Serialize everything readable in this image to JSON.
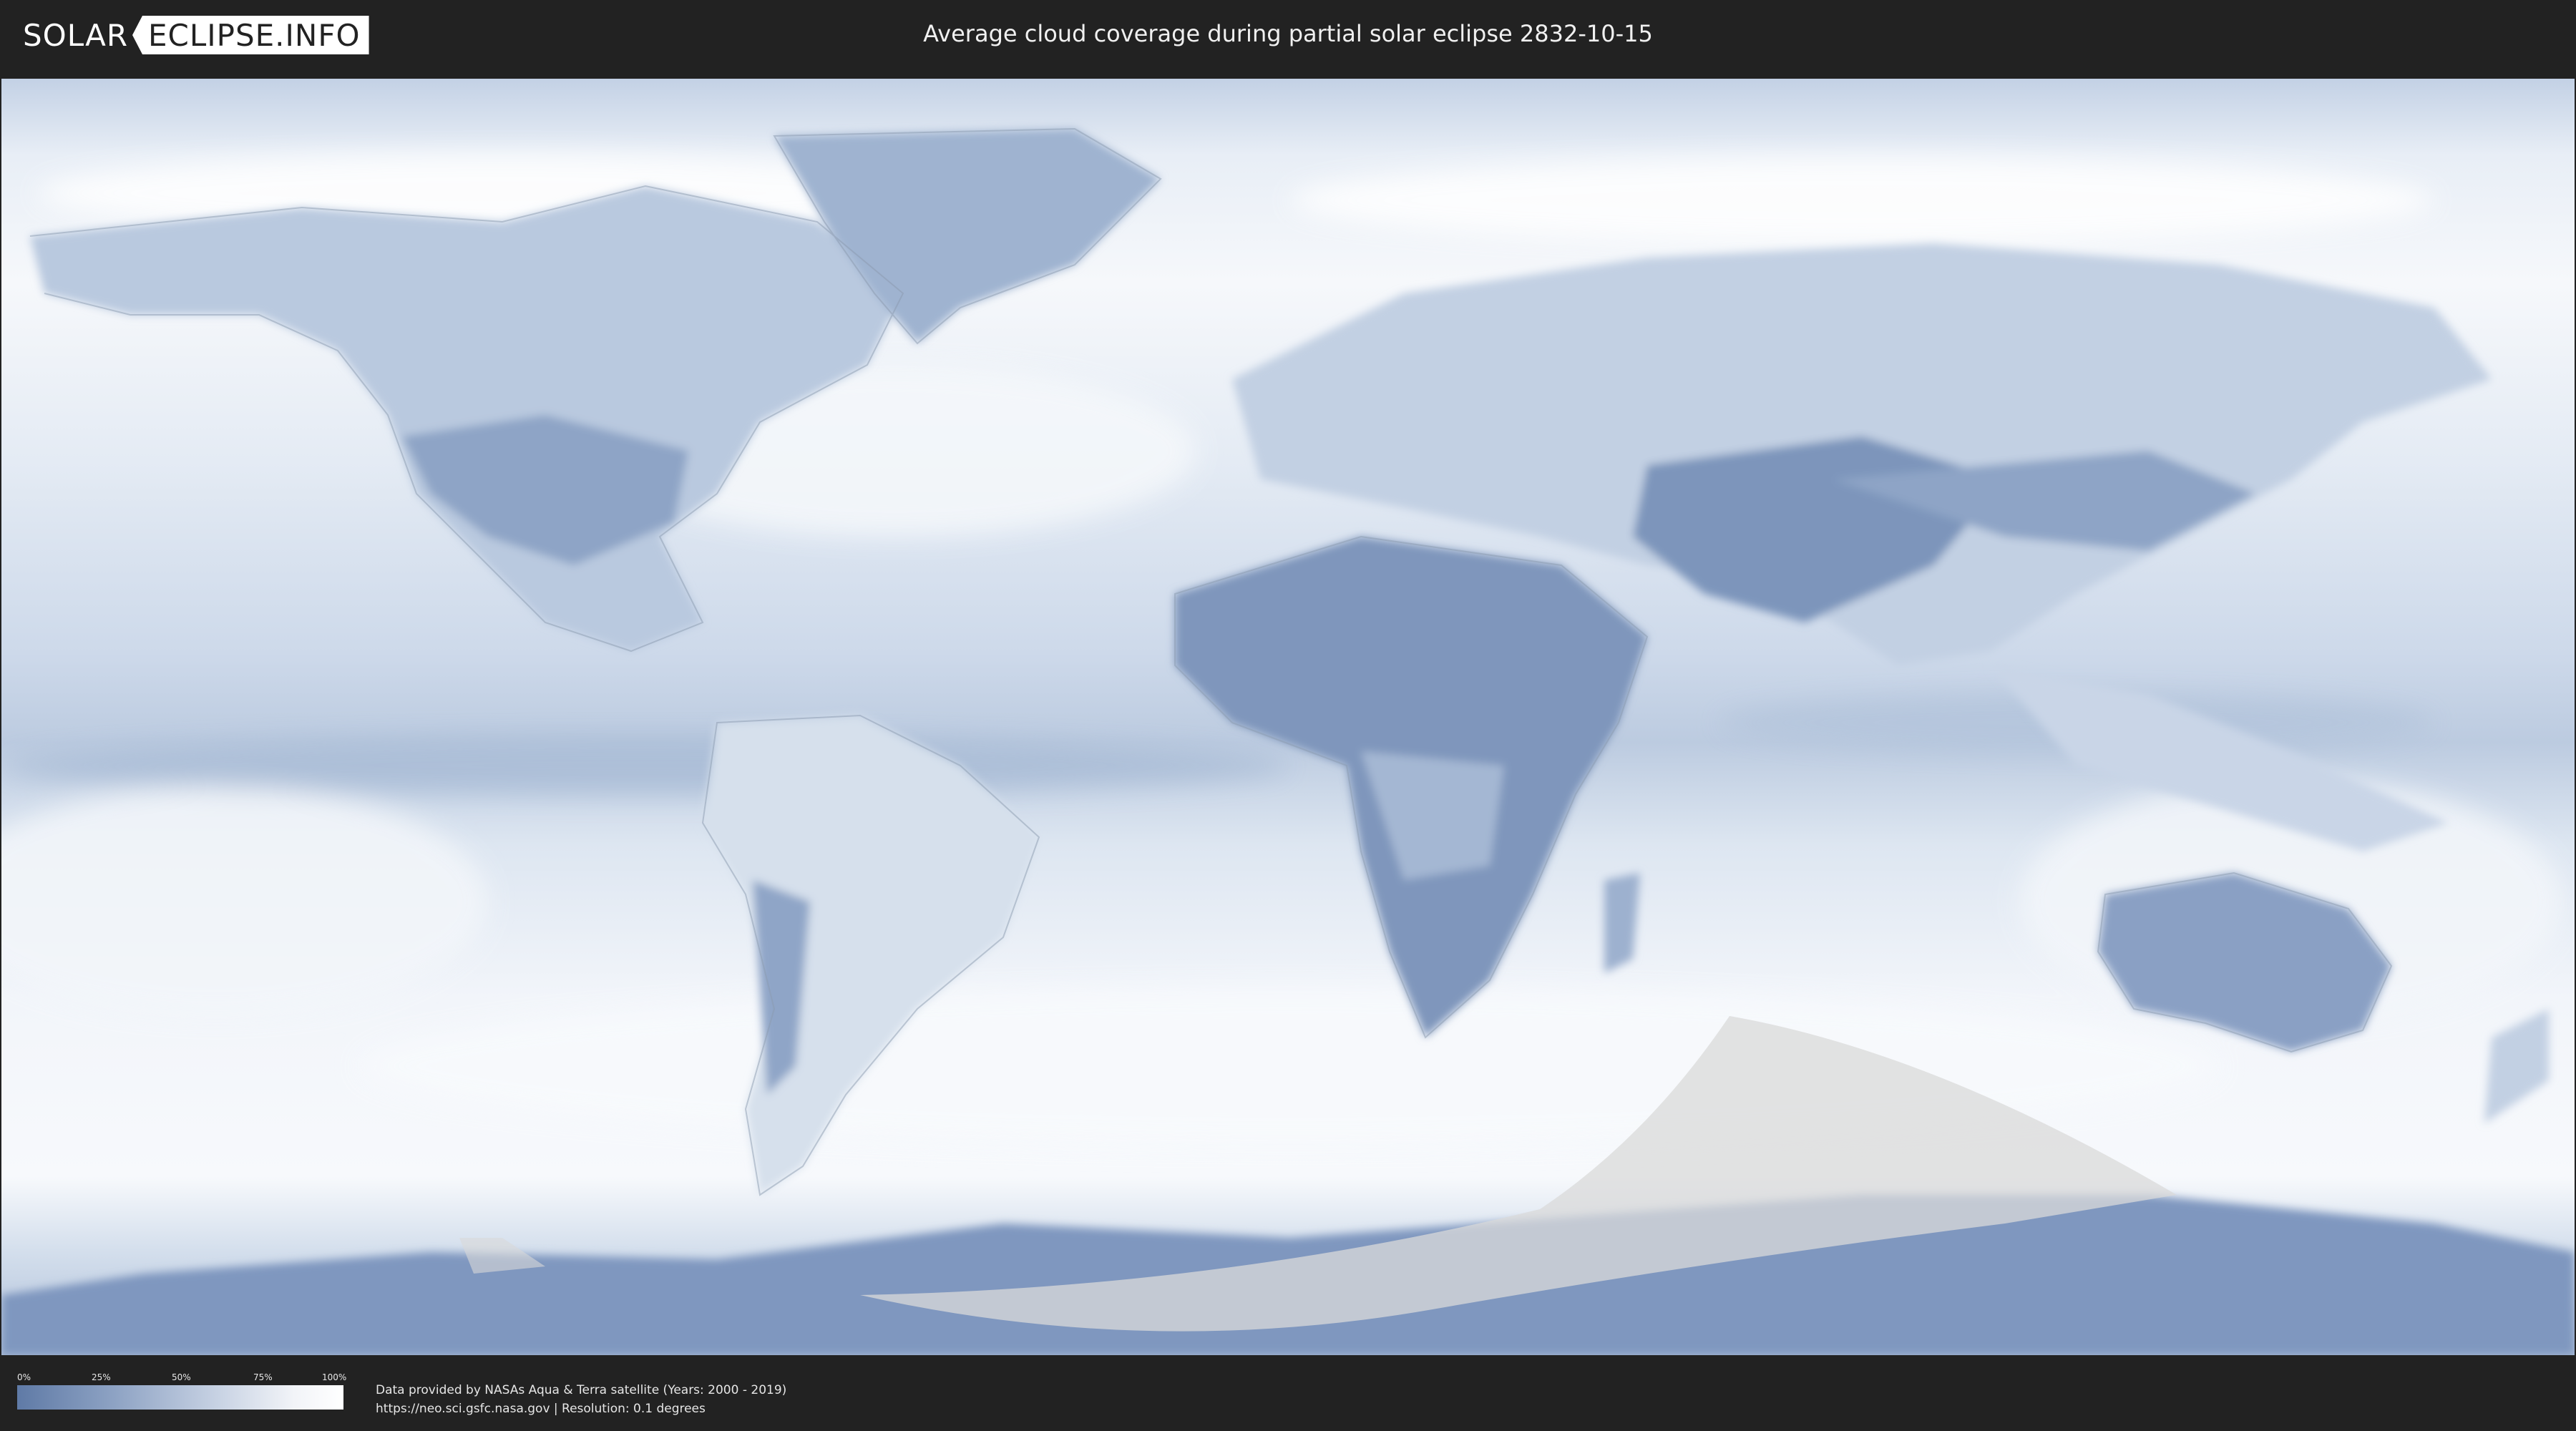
{
  "header": {
    "logo_left": "SOLAR",
    "logo_right": "ECLIPSE.INFO",
    "title": "Average cloud coverage during partial solar eclipse 2832-10-15"
  },
  "legend": {
    "ticks": [
      "0%",
      "25%",
      "50%",
      "75%",
      "100%"
    ],
    "colors": {
      "low": "#5f7aa6",
      "high": "#ffffff"
    }
  },
  "footer": {
    "credit_line1": "Data provided by NASAs Aqua & Terra satellite (Years: 2000 - 2019)",
    "credit_line2": "https://neo.sci.gsfc.nasa.gov | Resolution: 0.1 degrees"
  },
  "map": {
    "colors": {
      "cloudy": "#f4f6fa",
      "clear": "#6f88b2",
      "eclipse_zone": "#d9d9d9"
    }
  }
}
